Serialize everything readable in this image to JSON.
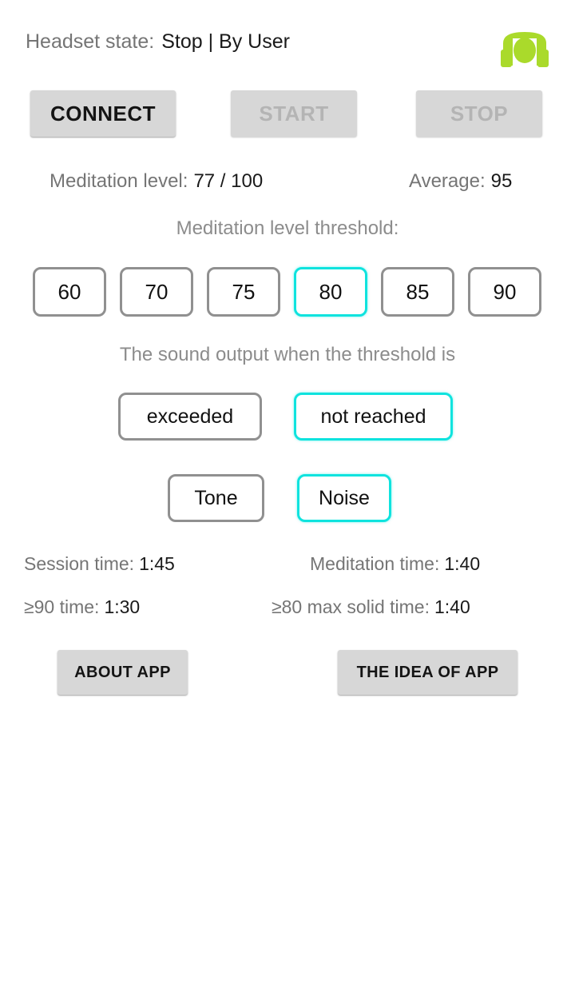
{
  "header": {
    "state_label": "Headset state:",
    "state_value": "Stop | By User",
    "logo_icon": "headset-icon",
    "logo_color": "#aada2b"
  },
  "top_buttons": {
    "connect": "CONNECT",
    "start": "START",
    "stop": "STOP"
  },
  "level": {
    "label": "Meditation level:",
    "value": "77 / 100",
    "average_label": "Average:",
    "average_value": "95"
  },
  "threshold": {
    "caption": "Meditation level threshold:",
    "options": [
      "60",
      "70",
      "75",
      "80",
      "85",
      "90"
    ],
    "selected": "80"
  },
  "sound": {
    "caption": "The sound output when the threshold is",
    "modes": [
      "exceeded",
      "not reached"
    ],
    "mode_selected": "not reached",
    "types": [
      "Tone",
      "Noise"
    ],
    "type_selected": "Noise"
  },
  "stats": {
    "session_time_label": "Session time:",
    "session_time_value": "1:45",
    "meditation_time_label": "Meditation time:",
    "meditation_time_value": "1:40",
    "ge90_time_label": "≥90 time:",
    "ge90_time_value": "1:30",
    "ge80_solid_label": "≥80 max solid time:",
    "ge80_solid_value": "1:40"
  },
  "bottom_buttons": {
    "about": "ABOUT APP",
    "idea": "THE IDEA OF APP"
  },
  "colors": {
    "accent_selected": "#0fe3de",
    "outline_default": "#909090",
    "muted_text": "#8c8c8c",
    "strong_text": "#111111",
    "button_face": "#d7d7d7",
    "disabled_text": "#b4b4b4",
    "background": "#ffffff"
  }
}
